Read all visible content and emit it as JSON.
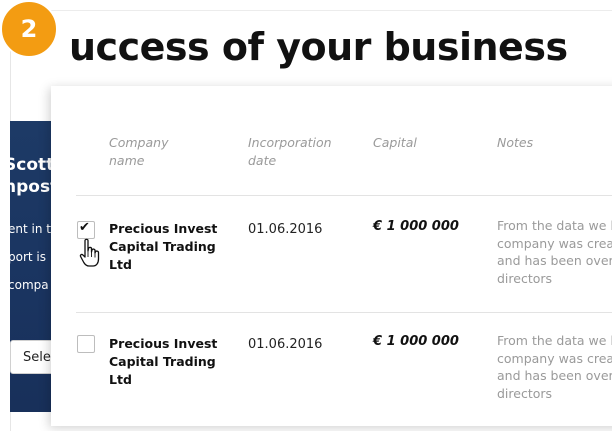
{
  "step": {
    "number": "2",
    "color": "#f39c12"
  },
  "headline": "uccess of your business",
  "background_panel": {
    "color": "#1d3a66",
    "name_lines": [
      "Scott",
      "npost"
    ],
    "desc_lines": [
      "ent in t",
      "port is",
      "compa"
    ],
    "select_text": "Sele"
  },
  "table": {
    "columns": [
      {
        "label_line1": "Company",
        "label_line2": "name"
      },
      {
        "label_line1": "Incorporation",
        "label_line2": "date"
      },
      {
        "label_line1": "Capital",
        "label_line2": ""
      },
      {
        "label_line1": "Notes",
        "label_line2": ""
      }
    ],
    "rows": [
      {
        "checked": true,
        "check_mark": "✔",
        "company": [
          "Precious Invest",
          "Capital Trading",
          "Ltd"
        ],
        "date": "01.06.2016",
        "capital": "€ 1 000 000",
        "notes": [
          "From the data we h",
          "company was crea",
          "and has been over",
          "directors"
        ]
      },
      {
        "checked": false,
        "check_mark": "",
        "company": [
          "Precious Invest",
          "Capital Trading",
          "Ltd"
        ],
        "date": "01.06.2016",
        "capital": "€ 1 000 000",
        "notes": [
          "From the data we h",
          "company was crea",
          "and has been over",
          "directors"
        ]
      }
    ]
  },
  "icons": {
    "cursor": "hand-pointer-icon",
    "check": "checkmark-icon"
  }
}
